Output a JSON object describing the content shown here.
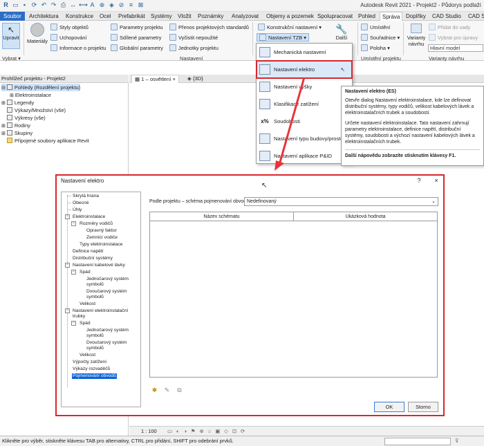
{
  "app_title": "Autodesk Revit 2021 - Projekt2 - Půdorys podlaží",
  "ribbon_tabs": [
    "Soubor",
    "Architektura",
    "Konstrukce",
    "Ocel",
    "Prefabrikát",
    "Systémy",
    "Vložit",
    "Poznámky",
    "Analyzovat",
    "Objemy a pozemek",
    "Spolupracovat",
    "Pohled",
    "Správa",
    "Doplňky",
    "CAD Studio",
    "CAD St"
  ],
  "active_tab": "Správa",
  "ribbon": {
    "select": {
      "modify": "Upravit",
      "select_label": "Vybrat",
      "materials": "Materiály"
    },
    "settings": {
      "object_styles": "Styly objektů",
      "snaps": "Uchopování",
      "project_info": "Informace o projektu",
      "project_params": "Parametry projektu",
      "shared_params": "Sdílené parametry",
      "global_params": "Globální parametry",
      "transfer_standards": "Přenos projektových standardů",
      "purge": "Vyčistit nepoužité",
      "units": "Jednotky projektu",
      "panel_label": "Nastavení"
    },
    "struct_settings": "Konstrukční  nastavení",
    "mep_settings": "Nastavení  TZB",
    "additional": "Další",
    "location": {
      "location": "Umístění",
      "coordinates": "Souřadnice",
      "position": "Poloha",
      "panel_label": "Umístění projektu"
    },
    "design_options": {
      "variants": "Varianty",
      "variants2": "návrhu",
      "add_to_set": "Přidat do sady",
      "pick_to_edit": "Vybrat pro úpravy",
      "main_model": "Hlavní model",
      "panel_label": "Varianty návrhu"
    }
  },
  "mep_menu": {
    "items": [
      "Mechanická nastavení",
      "Nastavení elektro",
      "Nastavení výšky",
      "Klasifikace zatížení",
      "Soudobosti",
      "Nastavení typu budovy/prostoru",
      "Nastavení aplikace P&ID"
    ],
    "highlighted": "Nastavení elektro"
  },
  "tooltip": {
    "title": "Nastavení elektro (ES)",
    "para1": "Otevře dialog Nastavení elektroinstalace, kde lze definovat distribuční systémy, typy vodičů, velikost kabelových lávek a elektroinstalačních trubek a soudobosti.",
    "para2": "Určete nastavení elektroinstalace. Tato nastavení zahrnují parametry elektroinstalace, definice napětí, distribuční systémy, soudobosti a výchozí nastavení kabelových lávek a elektroinstalačních trubek.",
    "footer": "Další nápovědu zobrazíte stisknutím klávesy F1."
  },
  "browser": {
    "title": "Prohlížeč projektu - Projekt2",
    "items": [
      "Pohledy (Rozdělení projektu)",
      "Elektroinstalace",
      "Legendy",
      "Výkazy/Množství (vše)",
      "Výkresy (vše)",
      "Rodiny",
      "Skupiny",
      "Připojené soubory aplikace Revit"
    ]
  },
  "view_tabs": [
    "1 – osvětlení",
    "{3D}"
  ],
  "dialog": {
    "title": "Nastavení elektro",
    "help": "?",
    "close": "×",
    "tree": [
      "Skrytá hrana",
      "Obecné",
      "Úhly",
      "Elektroinstalace",
      "Rozměry vodičů",
      "Opravný faktor",
      "Zemnicí vodiče",
      "Typy elektroinstalace",
      "Definice napětí",
      "Distribuční systémy",
      "Nastavení kabelové lávky",
      "Spád",
      "Jednočarový systém",
      "symbolů",
      "Dvoučarový systém",
      "symbolů",
      "Velikost",
      "Nastavení elektroinstalační",
      "trubky",
      "Spád",
      "Jednočarový systém",
      "symbolů",
      "Dvoučarový systém",
      "symbolů",
      "Velikost",
      "Výpočty zatížení",
      "Výkazy rozvaděčů",
      "Pojmenování obvodů"
    ],
    "selected": "Pojmenování obvodů",
    "scheme_label": "Podle projektu – schéma pojmenování obvodů:",
    "scheme_value": "Nedefinovaný",
    "columns": [
      "Název schématu",
      "Ukázková hodnota"
    ],
    "ok": "OK",
    "cancel": "Storno"
  },
  "view_control": {
    "scale": "1 : 100"
  },
  "status_text": "Klikněte pro výběr, stiskněte klávesu TAB pro alternativy, CTRL pro přidání, SHIFT pro odebrání prvků.",
  "colors": {
    "highlight_frame": "#d9262d",
    "file_tab": "#2c6ec7",
    "selection": "#0a64d6"
  }
}
